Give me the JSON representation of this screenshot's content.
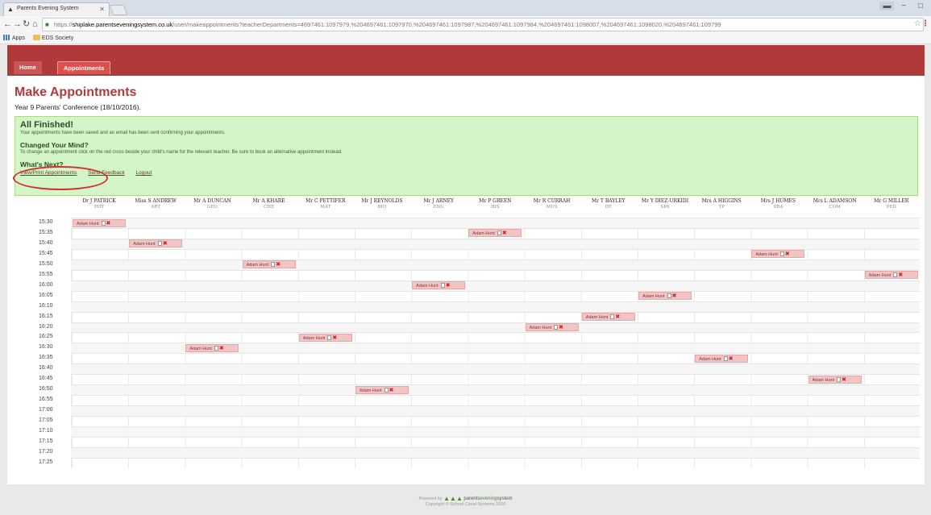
{
  "browser": {
    "tab_title": "Parents Evening System",
    "url_scheme": "https://",
    "url_host": "shiplake.parentseveningsystem.co.uk",
    "url_path": "/user/makeappointments?teacherDepartments=4697461:1097979,%204697461:1097970,%204697461:1097987,%204697461:1097984,%204697461:1098007,%204697461:1098020,%204697461:109799",
    "bookmarks": [
      {
        "label": "Apps",
        "icon": "apps-icon"
      },
      {
        "label": "EDS Society",
        "icon": "folder-icon"
      }
    ]
  },
  "nav": {
    "home": "Home",
    "appointments": "Appointments"
  },
  "page": {
    "title": "Make Appointments",
    "subtitle": "Year 9 Parents' Conference (18/10/2016)."
  },
  "finished": {
    "heading": "All Finished!",
    "message": "Your appointments have been saved and an email has been sent confirming your appointments.",
    "changed_heading": "Changed Your Mind?",
    "changed_message": "To change an appointment click on the red cross beside your child's name for the relevant teacher. Be sure to book an alternative appointment instead.",
    "next_heading": "What's Next?",
    "links": [
      "View/Print Appointments",
      "Send Feedback",
      "Logout"
    ]
  },
  "teachers": [
    {
      "name": "Dr J PATRICK",
      "subject": "PHY"
    },
    {
      "name": "Miss S ANDREW",
      "subject": "ART"
    },
    {
      "name": "Mr A DUNCAN",
      "subject": "GEO"
    },
    {
      "name": "Mr A KHARE",
      "subject": "CHE"
    },
    {
      "name": "Mr C PETTIFER",
      "subject": "MAT"
    },
    {
      "name": "Mr J REYNOLDS",
      "subject": "BIO"
    },
    {
      "name": "Mr J ARNEY",
      "subject": "ENG"
    },
    {
      "name": "Mr P GREEN",
      "subject": "HIS"
    },
    {
      "name": "Mr R CURRAH",
      "subject": "MUS"
    },
    {
      "name": "Mr T BAYLEY",
      "subject": "DT"
    },
    {
      "name": "Mr Y DIEZ-URKIDI",
      "subject": "SPA"
    },
    {
      "name": "Mrs A HIGGINS",
      "subject": "TP"
    },
    {
      "name": "Mrs J HUMES",
      "subject": "DRA"
    },
    {
      "name": "Mrs L ADAMSON",
      "subject": "COM"
    },
    {
      "name": "Mr G MILLER",
      "subject": "PED"
    }
  ],
  "times": [
    "15:30",
    "15:35",
    "15:40",
    "15:45",
    "15:50",
    "15:55",
    "16:00",
    "16:05",
    "16:10",
    "16:15",
    "16:20",
    "16:25",
    "16:30",
    "16:35",
    "16:40",
    "16:45",
    "16:50",
    "16:55",
    "17:00",
    "17:05",
    "17:10",
    "17:15",
    "17:20",
    "17:25"
  ],
  "appointments": [
    {
      "student": "Adam Hunt",
      "teacher": 0,
      "time": 0
    },
    {
      "student": "Adam Hunt",
      "teacher": 7,
      "time": 1
    },
    {
      "student": "Adam Hunt",
      "teacher": 1,
      "time": 2
    },
    {
      "student": "Adam Hunt",
      "teacher": 12,
      "time": 3
    },
    {
      "student": "Adam Hunt",
      "teacher": 3,
      "time": 4
    },
    {
      "student": "Adam Hunt",
      "teacher": 14,
      "time": 5
    },
    {
      "student": "Adam Hunt",
      "teacher": 6,
      "time": 6
    },
    {
      "student": "Adam Hunt",
      "teacher": 10,
      "time": 7
    },
    {
      "student": "Adam Hunt",
      "teacher": 9,
      "time": 9
    },
    {
      "student": "Adam Hunt",
      "teacher": 8,
      "time": 10
    },
    {
      "student": "Adam Hunt",
      "teacher": 4,
      "time": 11
    },
    {
      "student": "Adam Hunt",
      "teacher": 2,
      "time": 12
    },
    {
      "student": "Adam Hunt",
      "teacher": 11,
      "time": 13
    },
    {
      "student": "Adam Hunt",
      "teacher": 13,
      "time": 15
    },
    {
      "student": "Adam Hunt",
      "teacher": 5,
      "time": 16
    }
  ],
  "footer": {
    "powered": "Powered by",
    "brand_a": "parents",
    "brand_b": "evening",
    "brand_c": "system",
    "copyright": "Copyright © School Cloud Systems 2016"
  }
}
